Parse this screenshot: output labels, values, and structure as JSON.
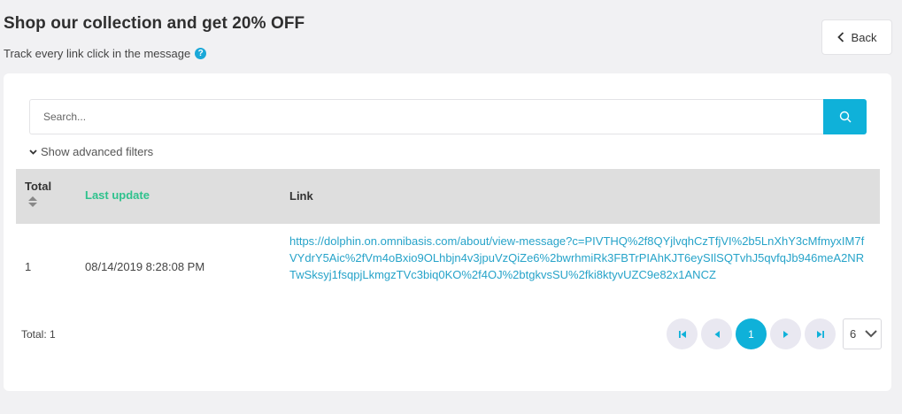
{
  "header": {
    "title": "Shop our collection and get 20% OFF",
    "subtitle": "Track every link click in the message",
    "help_glyph": "?",
    "back_label": "Back"
  },
  "search": {
    "placeholder": "Search..."
  },
  "filters": {
    "advanced_label": "Show advanced filters"
  },
  "table": {
    "columns": {
      "total": "Total",
      "last_update": "Last update",
      "link": "Link"
    },
    "rows": [
      {
        "total": "1",
        "last_update": "08/14/2019 8:28:08 PM",
        "link": "https://dolphin.on.omnibasis.com/about/view-message?c=PIVTHQ%2f8QYjlvqhCzTfjVI%2b5LnXhY3cMfmyxIM7fVYdrY5Aic%2fVm4oBxio9OLhbjn4v3jpuVzQiZe6%2bwrhmiRk3FBTrPIAhKJT6eySIlSQTvhJ5qvfqJb946meA2NRTwSksyj1fsqpjLkmgzTVc3biq0KO%2f4OJ%2btgkvsSU%2fki8ktyvUZC9e82x1ANCZ"
      }
    ]
  },
  "footer": {
    "total_label": "Total: 1"
  },
  "pagination": {
    "current_page": "1",
    "page_size": "6"
  },
  "colors": {
    "accent": "#0fb1d9",
    "sort_active": "#2ec28d",
    "link": "#26a3c9"
  }
}
